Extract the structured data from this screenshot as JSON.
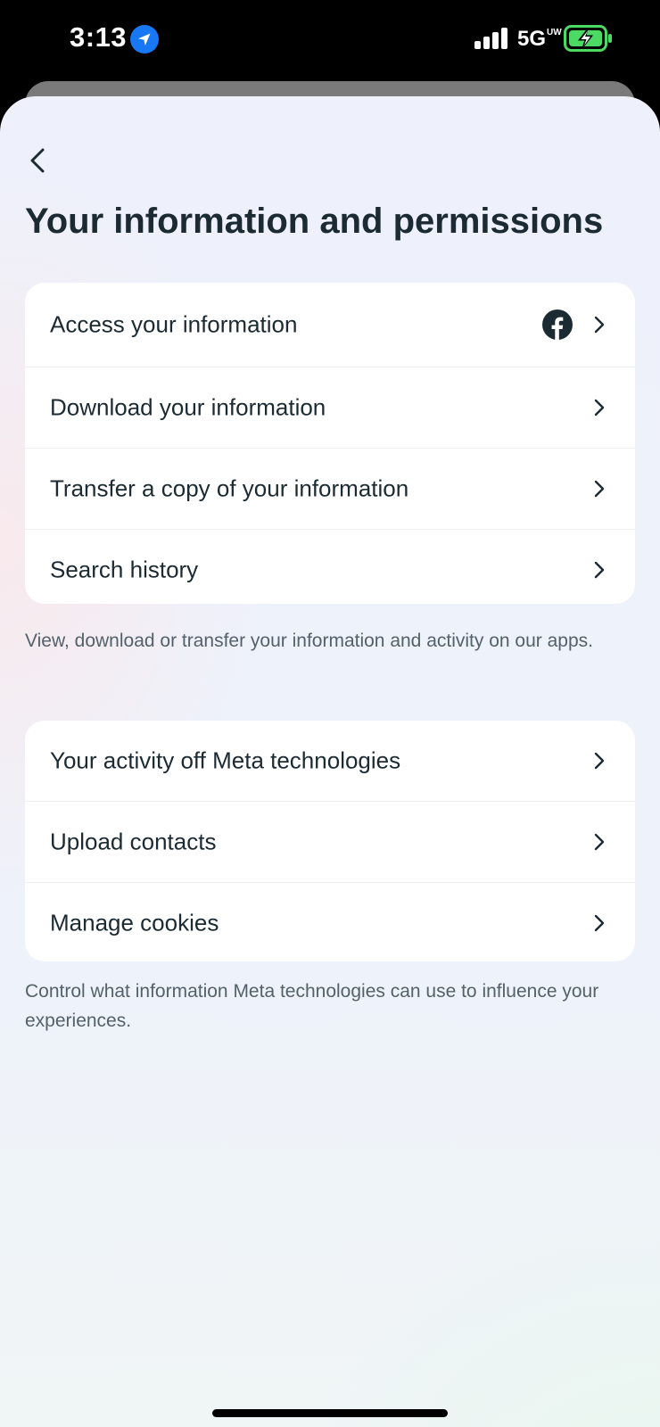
{
  "status_bar": {
    "time": "3:13",
    "network": "5G",
    "network_sub": "UW",
    "icons": [
      "location-arrow-icon",
      "cellular-signal-icon",
      "battery-charging-icon"
    ],
    "battery_color": "#4cd964",
    "location_color": "#1877f2"
  },
  "header": {
    "back_icon": "chevron-left-icon",
    "title": "Your information and permissions"
  },
  "sections": [
    {
      "items": [
        {
          "label": "Access your information",
          "badge_icon": "facebook-icon"
        },
        {
          "label": "Download your information"
        },
        {
          "label": "Transfer a copy of your information"
        },
        {
          "label": "Search history"
        }
      ],
      "caption": "View, download or transfer your information and activity on our apps."
    },
    {
      "items": [
        {
          "label": "Your activity off Meta technologies"
        },
        {
          "label": "Upload contacts"
        },
        {
          "label": "Manage cookies"
        }
      ],
      "caption": "Control what information Meta technologies can use to influence your experiences."
    }
  ],
  "colors": {
    "text_primary": "#1c2b33",
    "text_secondary": "#54616b",
    "card_background": "#ffffff",
    "facebook_icon": "#1c2b33"
  }
}
